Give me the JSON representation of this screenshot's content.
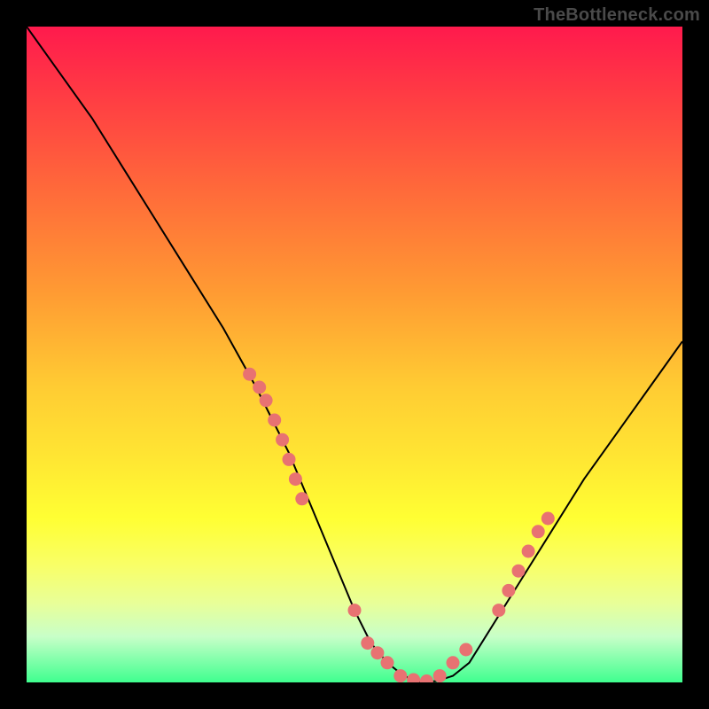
{
  "watermark": "TheBottleneck.com",
  "chart_data": {
    "type": "line",
    "title": "",
    "xlabel": "",
    "ylabel": "",
    "xlim": [
      0,
      100
    ],
    "ylim": [
      0,
      100
    ],
    "grid": false,
    "series": [
      {
        "name": "bottleneck-curve",
        "x": [
          0,
          5,
          10,
          15,
          20,
          25,
          30,
          35,
          40,
          45,
          47.5,
          50,
          52.5,
          55,
          57.5,
          60,
          62.5,
          65,
          67.5,
          70,
          75,
          80,
          85,
          90,
          95,
          100
        ],
        "values": [
          100,
          93,
          86,
          78,
          70,
          62,
          54,
          45,
          35,
          23,
          17,
          11,
          6,
          3,
          1,
          0,
          0.2,
          1,
          3,
          7,
          15,
          23,
          31,
          38,
          45,
          52
        ]
      }
    ],
    "highlight_clusters": [
      {
        "name": "left-cluster",
        "points_x": [
          34,
          35.5,
          36.5,
          37.8,
          39,
          40,
          41,
          42
        ],
        "points_y": [
          47,
          45,
          43,
          40,
          37,
          34,
          31,
          28
        ]
      },
      {
        "name": "bottom-cluster",
        "points_x": [
          50,
          52,
          53.5,
          55,
          57,
          59,
          61,
          63,
          65,
          67
        ],
        "points_y": [
          11,
          6,
          4.5,
          3,
          1,
          0.4,
          0.2,
          1,
          3,
          5
        ]
      },
      {
        "name": "right-cluster",
        "points_x": [
          72,
          73.5,
          75,
          76.5,
          78,
          79.5
        ],
        "points_y": [
          11,
          14,
          17,
          20,
          23,
          25
        ]
      }
    ],
    "colors": {
      "curve": "#000000",
      "dots": "#e87272",
      "background_top": "#ff1a4d",
      "background_bottom": "#3fff8f",
      "frame": "#000000"
    }
  }
}
